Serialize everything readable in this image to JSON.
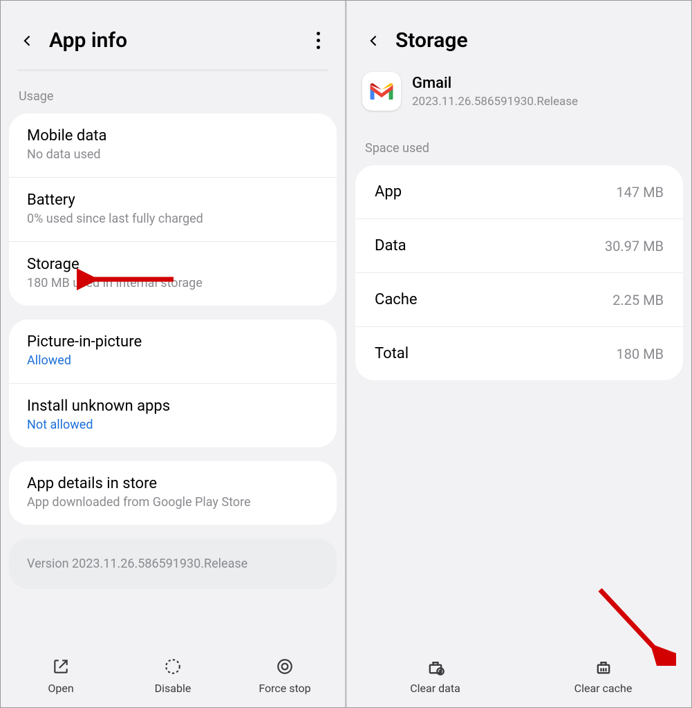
{
  "left": {
    "header": {
      "title": "App info"
    },
    "section_usage": "Usage",
    "rows": {
      "mobile": {
        "label": "Mobile data",
        "sub": "No data used"
      },
      "battery": {
        "label": "Battery",
        "sub": "0% used since last fully charged"
      },
      "storage": {
        "label": "Storage",
        "sub": "180 MB used in Internal storage"
      },
      "pip": {
        "label": "Picture-in-picture",
        "sub": "Allowed"
      },
      "unknown": {
        "label": "Install unknown apps",
        "sub": "Not allowed"
      },
      "details": {
        "label": "App details in store",
        "sub": "App downloaded from Google Play Store"
      }
    },
    "version": "Version 2023.11.26.586591930.Release",
    "buttons": {
      "open": "Open",
      "disable": "Disable",
      "force": "Force stop"
    }
  },
  "right": {
    "header": {
      "title": "Storage"
    },
    "app": {
      "name": "Gmail",
      "version": "2023.11.26.586591930.Release"
    },
    "section_space": "Space used",
    "space": {
      "app": {
        "k": "App",
        "v": "147 MB"
      },
      "data": {
        "k": "Data",
        "v": "30.97 MB"
      },
      "cache": {
        "k": "Cache",
        "v": "2.25 MB"
      },
      "total": {
        "k": "Total",
        "v": "180 MB"
      }
    },
    "buttons": {
      "clear_data": "Clear data",
      "clear_cache": "Clear cache"
    }
  }
}
